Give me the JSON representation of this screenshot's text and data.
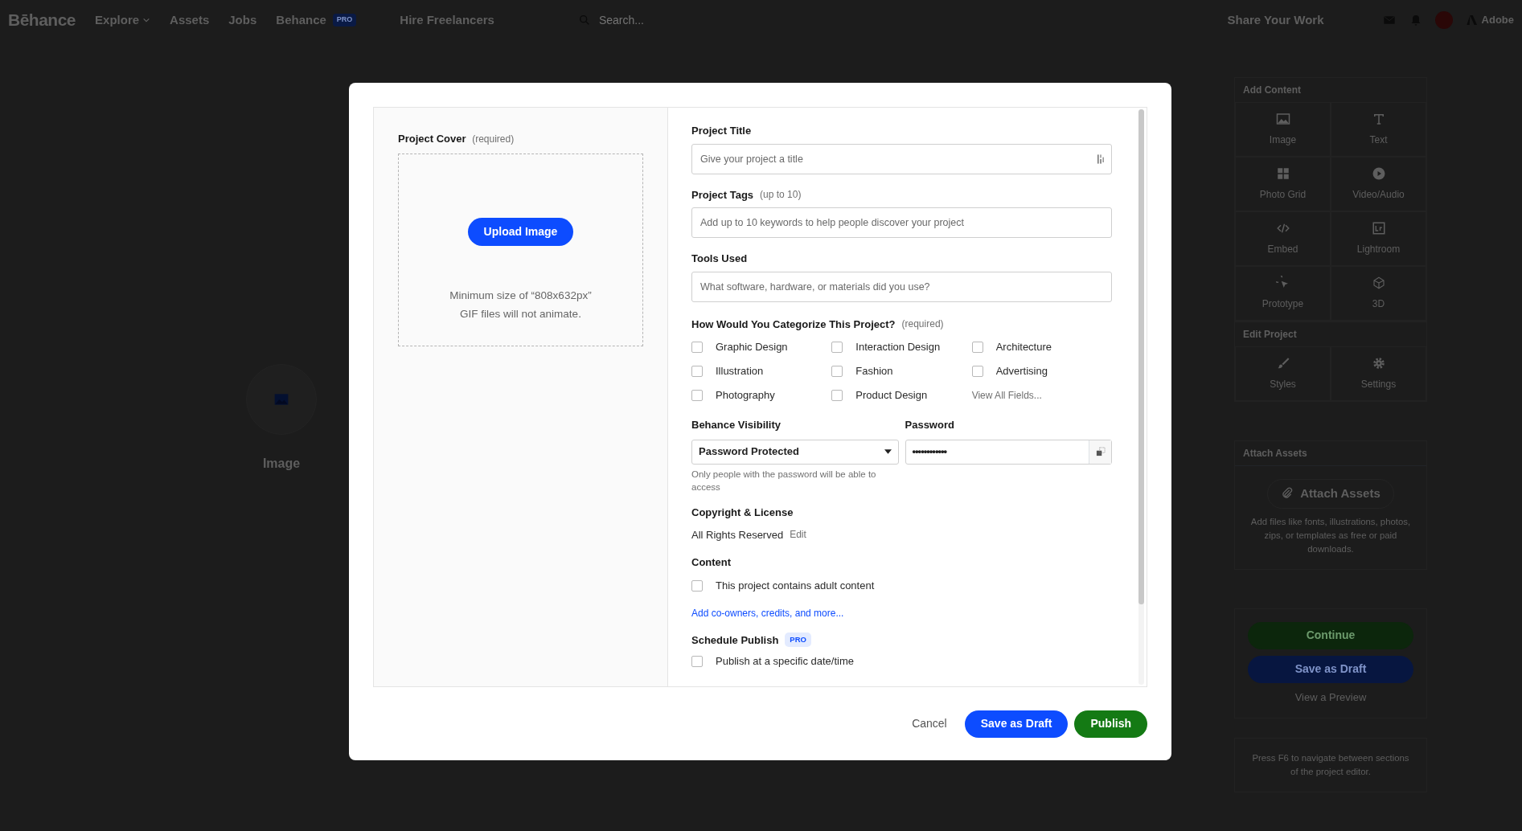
{
  "top_nav": {
    "logo": "Bēhance",
    "links": [
      {
        "label": "Explore",
        "dropdown": true
      },
      {
        "label": "Assets",
        "dropdown": false
      },
      {
        "label": "Jobs",
        "dropdown": false
      },
      {
        "label": "Behance",
        "dropdown": false,
        "badge": "PRO"
      },
      {
        "label": "Hire Freelancers",
        "dropdown": false
      }
    ],
    "search": {
      "placeholder": "Search..."
    },
    "share": "Share Your Work",
    "brand": "Adobe"
  },
  "canvas": {
    "block_label": "Image"
  },
  "sidebar": {
    "sections": [
      {
        "title": "Add Content",
        "tools": [
          {
            "label": "Image"
          },
          {
            "label": "Text"
          },
          {
            "label": "Photo Grid"
          },
          {
            "label": "Video/Audio"
          },
          {
            "label": "Embed"
          },
          {
            "label": "Lightroom"
          },
          {
            "label": "Prototype"
          },
          {
            "label": "3D"
          }
        ]
      },
      {
        "title": "Edit Project",
        "tools": [
          {
            "label": "Styles"
          },
          {
            "label": "Settings"
          }
        ]
      }
    ],
    "attach": {
      "title": "Attach Assets",
      "button": "Attach Assets",
      "note": "Add files like fonts, illustrations, photos, zips, or templates as free or paid downloads."
    },
    "actions": {
      "continue": "Continue",
      "save_draft": "Save as Draft",
      "preview": "View a Preview"
    },
    "hint": "Press F6 to navigate between sections of the project editor."
  },
  "modal": {
    "cover": {
      "label": "Project Cover",
      "note": "(required)",
      "button": "Upload Image",
      "hints": [
        "Minimum size of “808x632px”",
        "GIF files will not animate."
      ]
    },
    "fields": [
      {
        "label": "Project Title",
        "placeholder": "Give your project a title"
      },
      {
        "label": "Project Tags",
        "note": "(up to 10)",
        "placeholder": "Add up to 10 keywords to help people discover your project"
      },
      {
        "label": "Tools Used",
        "placeholder": "What software, hardware, or materials did you use?"
      }
    ],
    "categories": {
      "label": "How Would You Categorize This Project?",
      "note": "(required)",
      "options": [
        {
          "label": "Graphic Design",
          "checked": false
        },
        {
          "label": "Interaction Design",
          "checked": false
        },
        {
          "label": "Architecture",
          "checked": false
        },
        {
          "label": "Illustration",
          "checked": false
        },
        {
          "label": "Fashion",
          "checked": false
        },
        {
          "label": "Advertising",
          "checked": false
        },
        {
          "label": "Photography",
          "checked": false
        },
        {
          "label": "Product Design",
          "checked": false
        }
      ],
      "more": "View All Fields..."
    },
    "visibility": {
      "label": "Behance Visibility",
      "value": "Password Protected",
      "help": "Only people with the password will be able to access"
    },
    "password": {
      "label": "Password",
      "value": "••••••••••••"
    },
    "copyright": {
      "label": "Copyright & License",
      "value": "All Rights Reserved",
      "action": "Edit"
    },
    "content": {
      "label": "Content",
      "option": {
        "label": "This project contains adult content",
        "checked": false
      }
    },
    "more_link": "Add co-owners, credits, and more...",
    "schedule": {
      "label": "Schedule Publish",
      "badge": "PRO",
      "option": {
        "label": "Publish at a specific date/time",
        "checked": false
      }
    },
    "buttons": {
      "cancel": "Cancel",
      "save_draft": "Save as Draft",
      "publish": "Publish"
    }
  }
}
